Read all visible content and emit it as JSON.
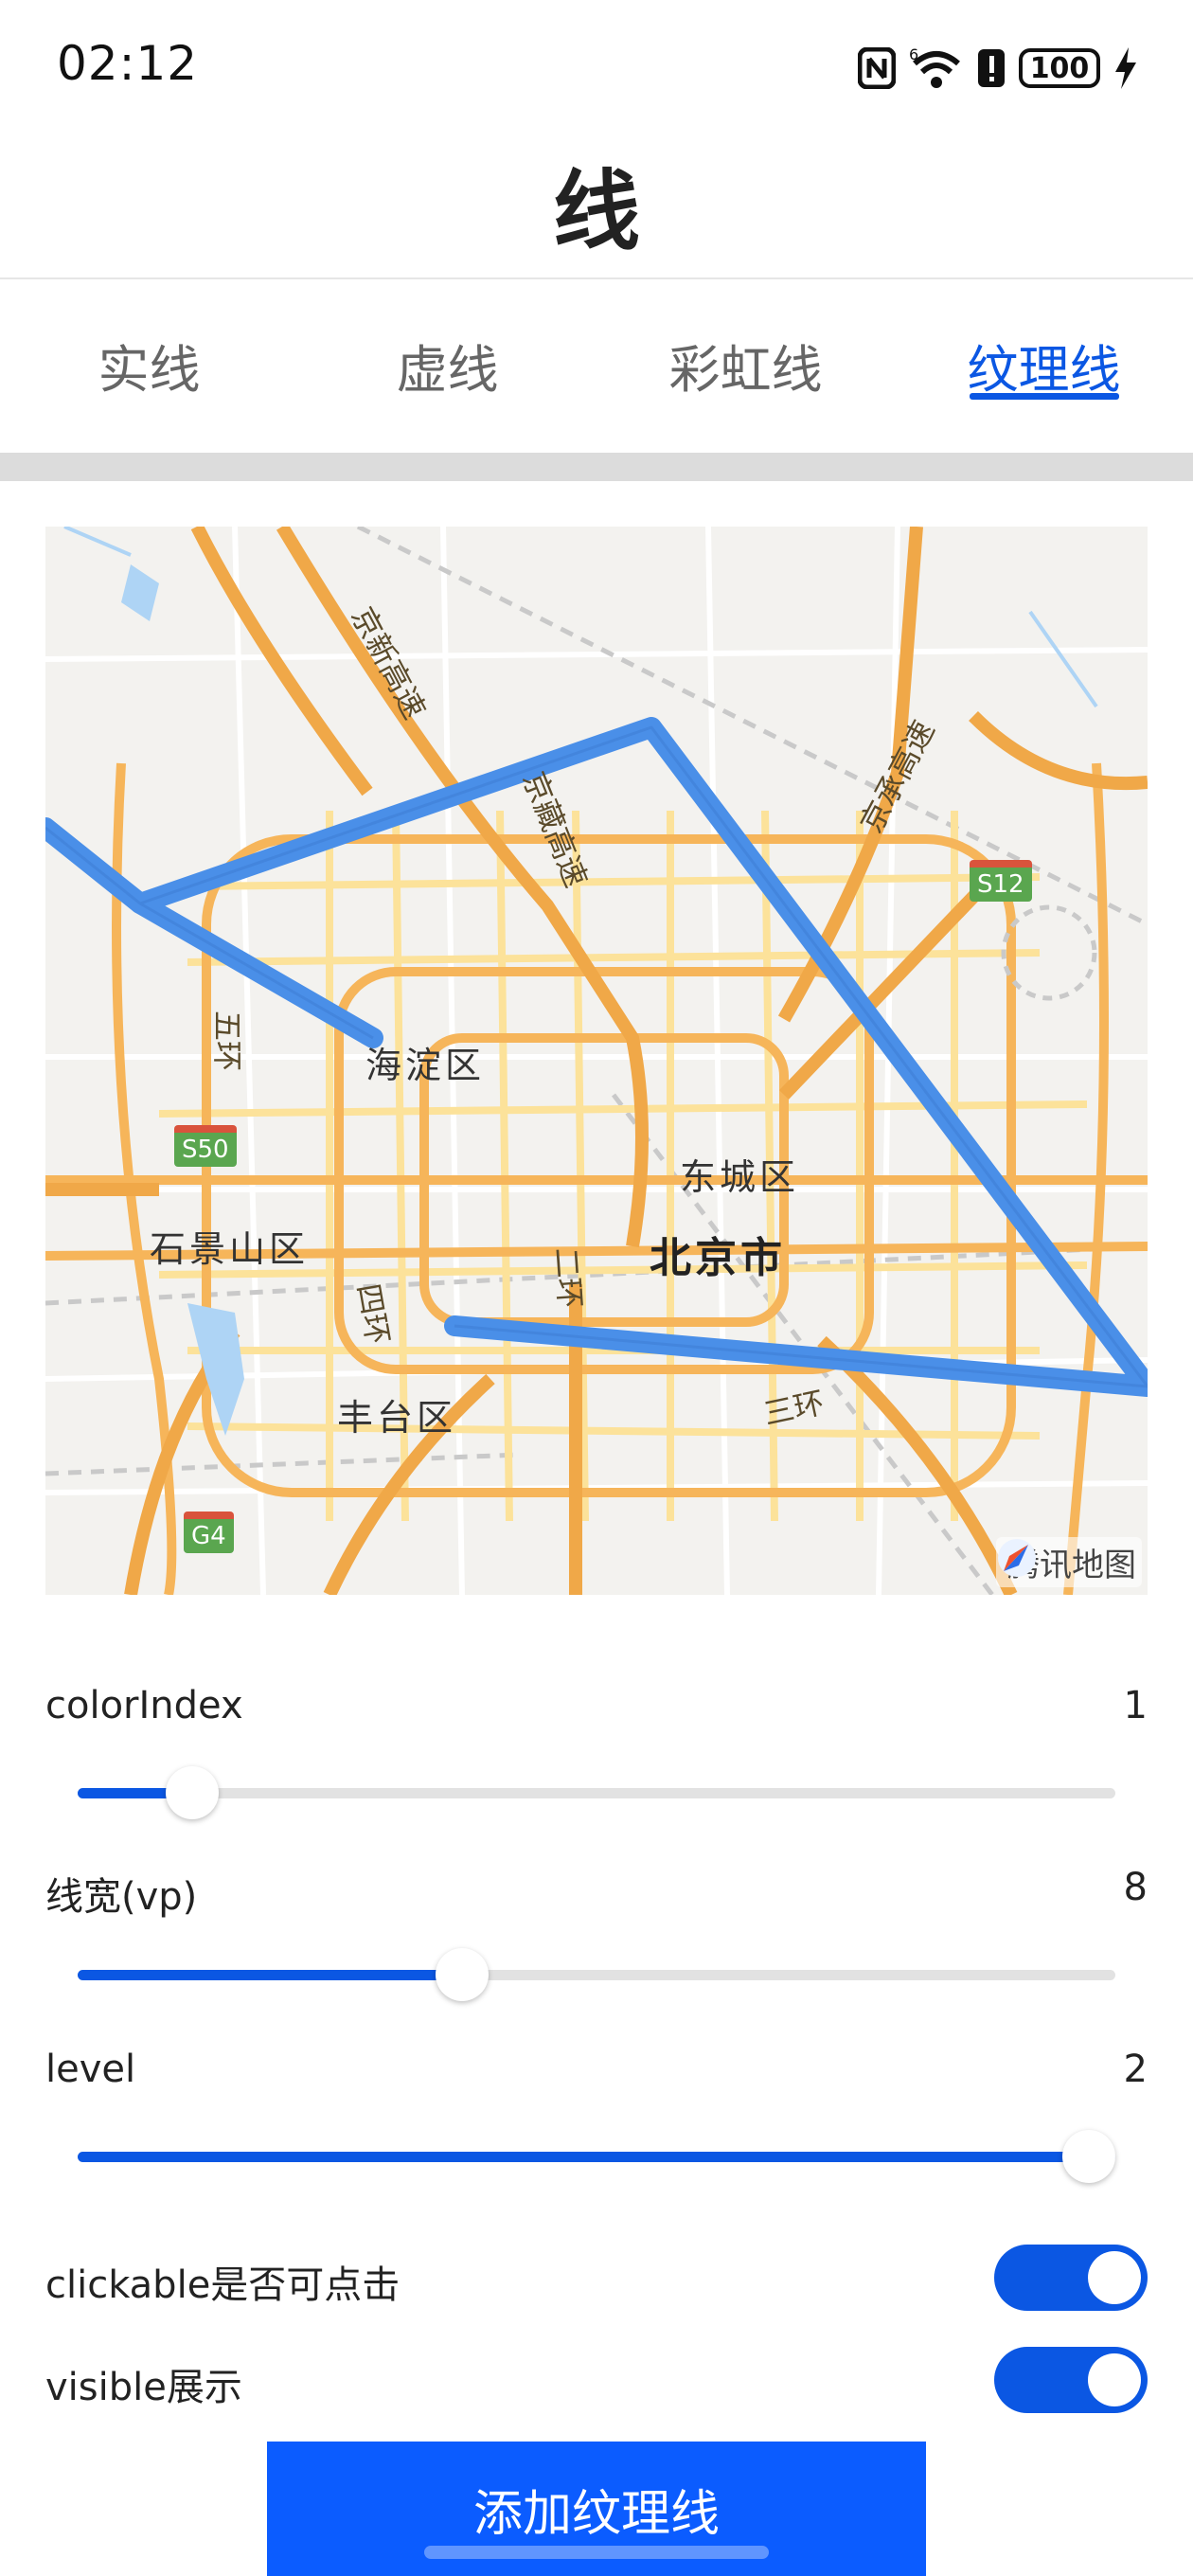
{
  "status_bar": {
    "time": "02:12",
    "battery": "100",
    "icons": [
      "nfc-icon",
      "wifi-6-icon",
      "alert-icon",
      "battery-icon",
      "charging-icon"
    ]
  },
  "header": {
    "title": "线"
  },
  "tabs": [
    {
      "label": "实线",
      "active": false
    },
    {
      "label": "虚线",
      "active": false
    },
    {
      "label": "彩虹线",
      "active": false
    },
    {
      "label": "纹理线",
      "active": true
    }
  ],
  "map": {
    "labels": {
      "haidian": "海淀区",
      "dongcheng": "东城区",
      "beijing": "北京市",
      "shijingshan": "石景山区",
      "fengtai": "丰台区",
      "road_jingxin": "京新高速",
      "road_jingzang": "京藏高速",
      "road_jingcheng": "京承高速",
      "ring_5": "五环",
      "ring_4": "四环",
      "ring_3": "三环",
      "ring_2": "二环"
    },
    "shields": {
      "s12": "S12",
      "s50": "S50",
      "g4": "G4"
    },
    "attribution": "腾讯地图"
  },
  "controls": {
    "color_index": {
      "label": "colorIndex",
      "value": "1",
      "fraction": 0.11
    },
    "line_width": {
      "label": "线宽(vp)",
      "value": "8",
      "fraction": 0.37
    },
    "level": {
      "label": "level",
      "value": "2",
      "fraction": 1.0
    }
  },
  "toggles": {
    "clickable": {
      "label": "clickable是否可点击",
      "on": true
    },
    "visible": {
      "label": "visible展示",
      "on": true
    }
  },
  "add_button": {
    "label": "添加纹理线"
  },
  "colors": {
    "accent": "#0b57e3",
    "polyline": "#4a8fe8",
    "button": "#0b5cff"
  }
}
